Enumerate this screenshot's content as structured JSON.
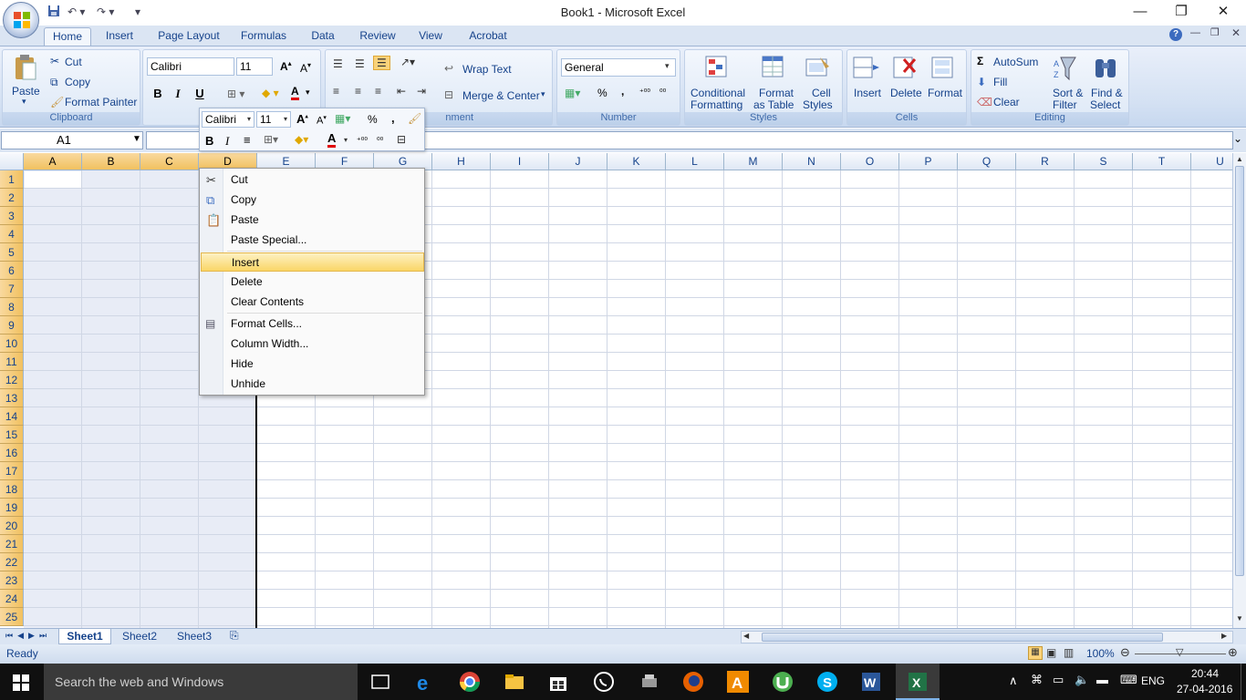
{
  "window": {
    "title": "Book1 - Microsoft Excel",
    "minimize": "—",
    "restore": "❐",
    "close": "✕"
  },
  "tabs": [
    "Home",
    "Insert",
    "Page Layout",
    "Formulas",
    "Data",
    "Review",
    "View",
    "Acrobat"
  ],
  "ribbon": {
    "clipboard": {
      "paste": "Paste",
      "cut": "Cut",
      "copy": "Copy",
      "format_painter": "Format Painter",
      "label": "Clipboard"
    },
    "font": {
      "name": "Calibri",
      "size": "11",
      "bold": "B",
      "italic": "I",
      "underline": "U"
    },
    "alignment": {
      "wrap_text": "Wrap Text",
      "merge_center": "Merge & Center",
      "label": "nment"
    },
    "number": {
      "format": "General",
      "percent": "%",
      "comma": ",",
      "label": "Number"
    },
    "styles": {
      "conditional1": "Conditional",
      "conditional2": "Formatting",
      "format_table1": "Format",
      "format_table2": "as Table",
      "cell_styles1": "Cell",
      "cell_styles2": "Styles",
      "label": "Styles"
    },
    "cells": {
      "insert": "Insert",
      "delete": "Delete",
      "format": "Format",
      "label": "Cells"
    },
    "editing": {
      "autosum": "AutoSum",
      "fill": "Fill",
      "clear": "Clear",
      "sort1": "Sort &",
      "sort2": "Filter",
      "find1": "Find &",
      "find2": "Select",
      "label": "Editing"
    }
  },
  "formula_bar": {
    "name_box": "A1"
  },
  "columns": [
    "A",
    "B",
    "C",
    "D",
    "E",
    "F",
    "G",
    "H",
    "I",
    "J",
    "K",
    "L",
    "M",
    "N",
    "O",
    "P",
    "Q",
    "R",
    "S",
    "T",
    "U"
  ],
  "rows": [
    "1",
    "2",
    "3",
    "4",
    "5",
    "6",
    "7",
    "8",
    "9",
    "10",
    "11",
    "12",
    "13",
    "14",
    "15",
    "16",
    "17",
    "18",
    "19",
    "20",
    "21",
    "22",
    "23",
    "24",
    "25"
  ],
  "mini_toolbar": {
    "font": "Calibri",
    "size": "11",
    "bold": "B",
    "italic": "I",
    "percent": "%",
    "comma": ","
  },
  "context_menu": {
    "items": [
      "Cut",
      "Copy",
      "Paste",
      "Paste Special...",
      "Insert",
      "Delete",
      "Clear Contents",
      "Format Cells...",
      "Column Width...",
      "Hide",
      "Unhide"
    ],
    "highlighted": "Insert"
  },
  "sheets": [
    "Sheet1",
    "Sheet2",
    "Sheet3"
  ],
  "status": {
    "ready": "Ready",
    "zoom": "100%"
  },
  "taskbar": {
    "search": "Search the web and Windows",
    "lang": "ENG",
    "time": "20:44",
    "date": "27-04-2016"
  }
}
